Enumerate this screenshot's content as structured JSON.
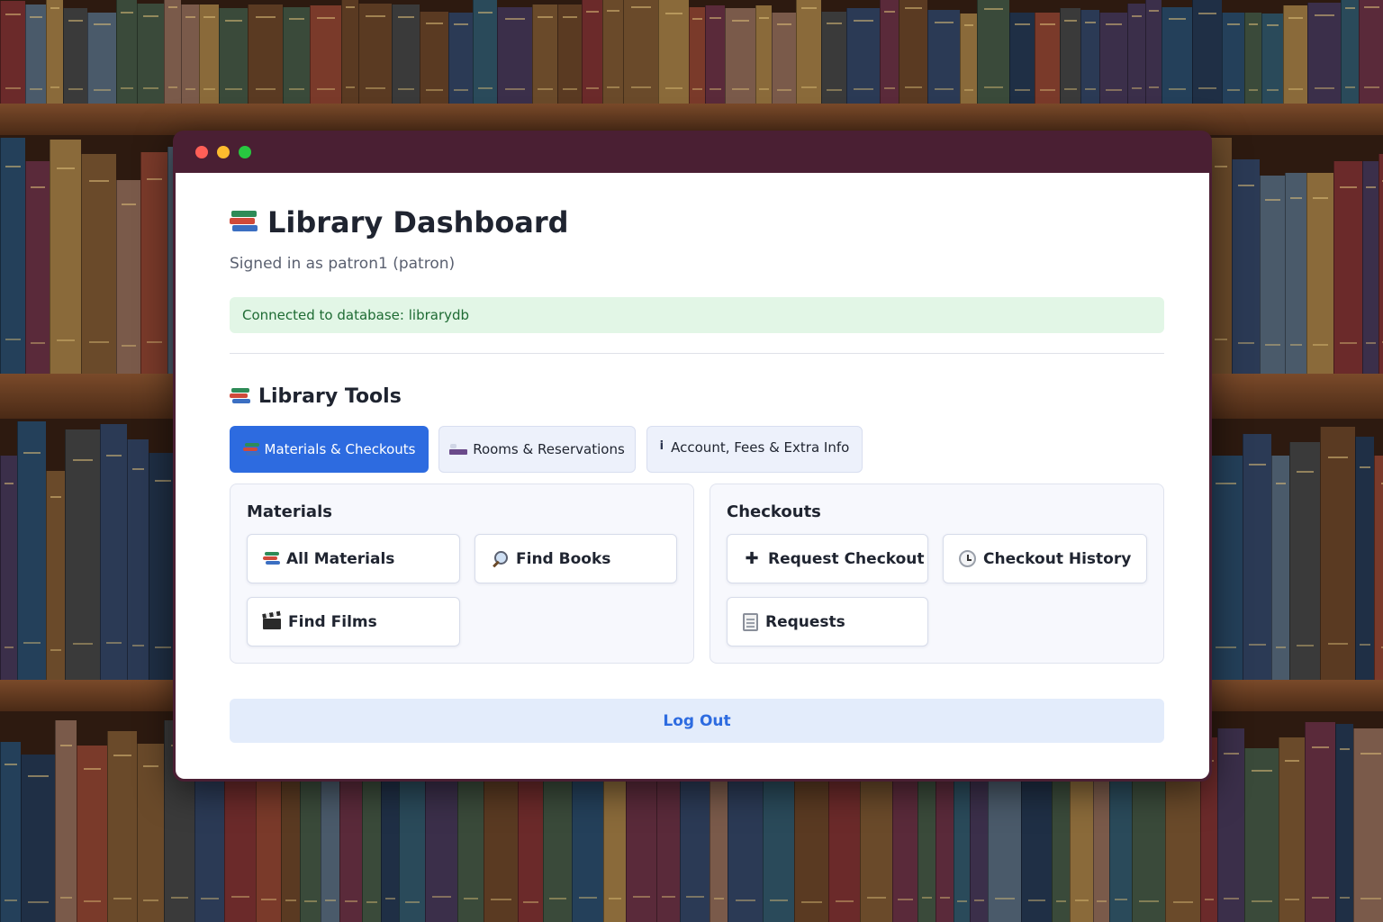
{
  "window": {
    "controls": [
      "close",
      "minimize",
      "maximize"
    ]
  },
  "header": {
    "title": "Library Dashboard",
    "subtitle": "Signed in as patron1 (patron)"
  },
  "status": {
    "db_message": "Connected to database: librarydb"
  },
  "tools": {
    "title": "Library Tools",
    "tabs": [
      {
        "label": "Materials & Checkouts",
        "icon": "books-icon",
        "active": true
      },
      {
        "label": "Rooms & Reservations",
        "icon": "bed-icon",
        "active": false
      },
      {
        "label": "Account, Fees & Extra Info",
        "icon": "info-icon",
        "active": false
      }
    ]
  },
  "materials": {
    "title": "Materials",
    "buttons": [
      {
        "label": "All Materials",
        "icon": "books-icon"
      },
      {
        "label": "Find Books",
        "icon": "magnifier-icon"
      },
      {
        "label": "Find Films",
        "icon": "clapper-icon"
      }
    ]
  },
  "checkouts": {
    "title": "Checkouts",
    "buttons": [
      {
        "label": "Request Checkout",
        "icon": "plus-icon"
      },
      {
        "label": "Checkout History",
        "icon": "clock-icon"
      },
      {
        "label": "Requests",
        "icon": "memo-icon"
      }
    ]
  },
  "logout": {
    "label": "Log Out"
  },
  "colors": {
    "accent": "#2d6be0",
    "titlebar": "#4a1f33",
    "success_bg": "#e2f6e6",
    "success_text": "#1e6b33"
  }
}
